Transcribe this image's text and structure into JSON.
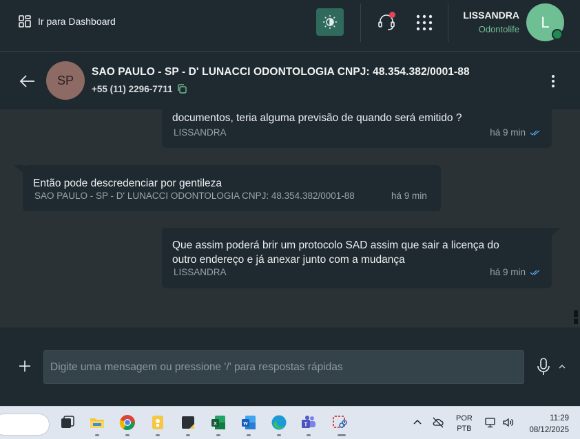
{
  "topbar": {
    "dashboard_label": "Ir para Dashboard",
    "user_name": "LISSANDRA",
    "user_org": "Odontolife",
    "avatar_initial": "L",
    "colors": {
      "accent_green": "#6fbf95",
      "notification": "#e64553",
      "theme_button": "#2f6a5c"
    }
  },
  "chat": {
    "avatar_initials": "SP",
    "title": "SAO PAULO - SP - D' LUNACCI ODONTOLOGIA CNPJ: 48.354.382/0001-88",
    "phone": "+55 (11) 2296-7711"
  },
  "messages": [
    {
      "direction": "outgoing",
      "text": "documentos, teria alguma previsão de quando será emitido ?",
      "sender": "LISSANDRA",
      "time": "há 9 min",
      "status": "read-double-check"
    },
    {
      "direction": "incoming",
      "text": "Então pode descredenciar por gentileza",
      "sender": "SAO PAULO - SP - D' LUNACCI ODONTOLOGIA CNPJ: 48.354.382/0001-88",
      "time": "há 9 min"
    },
    {
      "direction": "outgoing",
      "text_line1": "Que assim poderá brir um protocolo SAD assim que sair a licença do",
      "text_line2": "outro endereço e já anexar junto com a mudança",
      "sender": "LISSANDRA",
      "time": "há 9 min",
      "status": "read-double-check"
    }
  ],
  "composer": {
    "placeholder": "Digite uma mensagem ou pressione '/' para respostas rápidas",
    "value": ""
  },
  "taskbar": {
    "apps": [
      "file-explorer-icon",
      "chrome-icon",
      "sticky-notes-icon",
      "notepad-icon",
      "excel-icon",
      "word-icon",
      "edge-icon",
      "teams-icon",
      "snipping-tool-icon"
    ],
    "lang_line1": "POR",
    "lang_line2": "PTB",
    "time": "11:29",
    "date": "08/12/2025"
  }
}
